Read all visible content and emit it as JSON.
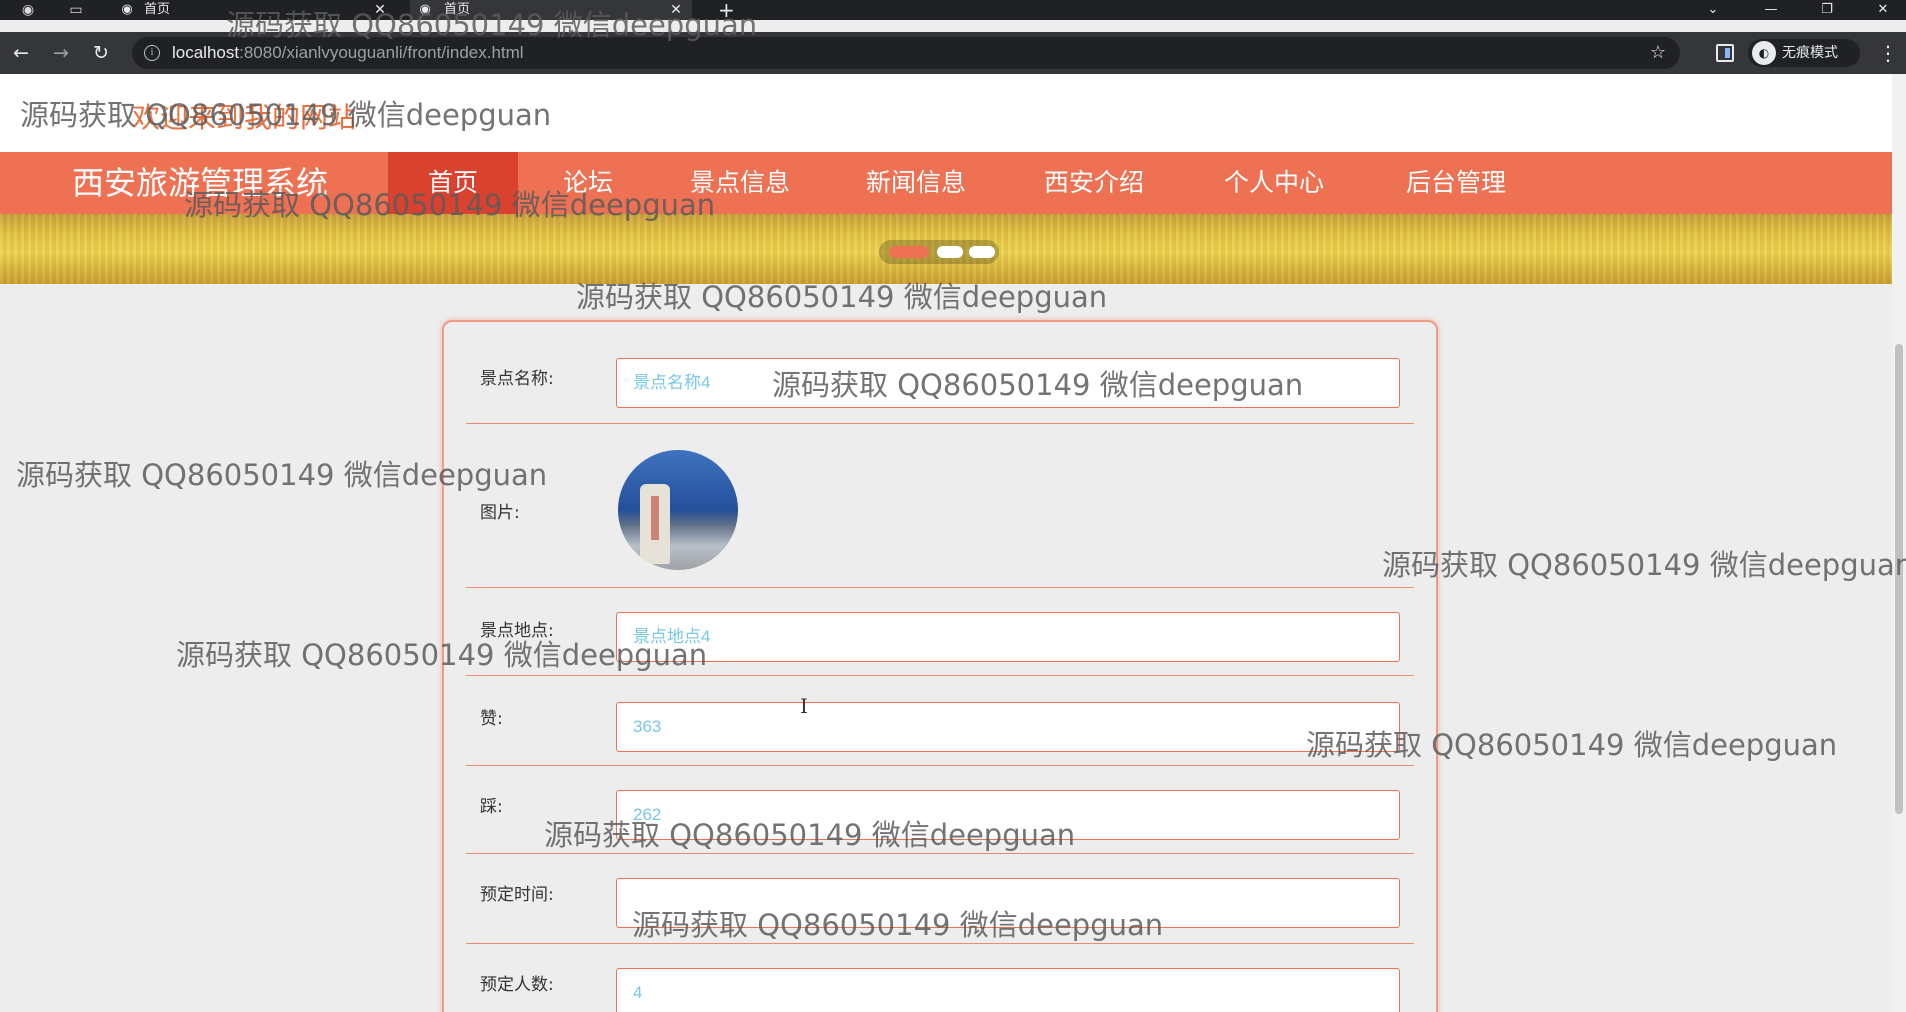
{
  "browser": {
    "tabs": [
      {
        "title": "首页",
        "close": "✕"
      },
      {
        "title": "首页",
        "close": "✕"
      }
    ],
    "new_tab": "+",
    "url_host": "localhost",
    "url_rest": ":8080/xianlvyouguanli/front/index.html",
    "incognito_label": "无痕模式"
  },
  "site": {
    "welcome": "欢迎来到我的网站",
    "brand": "西安旅游管理系统",
    "nav": [
      "首页",
      "论坛",
      "景点信息",
      "新闻信息",
      "西安介绍",
      "个人中心",
      "后台管理"
    ],
    "nav_active_index": 0,
    "carousel_slide_count": 3,
    "carousel_active_index": 0
  },
  "detail": {
    "name_label": "景点名称:",
    "name_value": "景点名称4",
    "image_label": "图片:",
    "location_label": "景点地点:",
    "location_value": "景点地点4",
    "likes_label": "赞:",
    "likes_value": "363",
    "dislikes_label": "踩:",
    "dislikes_value": "262",
    "booking_time_label": "预定时间:",
    "booking_time_value": "",
    "booking_count_label": "预定人数:",
    "booking_count_value": "4"
  },
  "watermark": "源码获取 QQ86050149 微信deepguan",
  "colors": {
    "accent": "#ed7152",
    "accent_dark": "#d9422e",
    "input_text": "#78c7e8",
    "welcome": "#e9713f"
  }
}
